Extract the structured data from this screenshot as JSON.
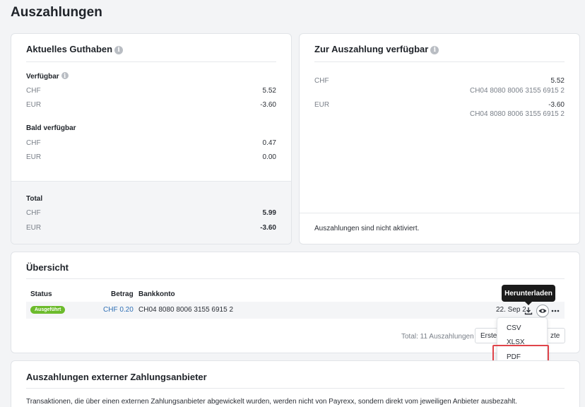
{
  "page": {
    "title": "Auszahlungen"
  },
  "balance": {
    "title": "Aktuelles Guthaben",
    "available": {
      "label": "Verfügbar",
      "rows": [
        {
          "currency": "CHF",
          "amount": "5.52"
        },
        {
          "currency": "EUR",
          "amount": "-3.60"
        }
      ]
    },
    "soon": {
      "label": "Bald verfügbar",
      "rows": [
        {
          "currency": "CHF",
          "amount": "0.47"
        },
        {
          "currency": "EUR",
          "amount": "0.00"
        }
      ]
    },
    "total": {
      "label": "Total",
      "rows": [
        {
          "currency": "CHF",
          "amount": "5.99"
        },
        {
          "currency": "EUR",
          "amount": "-3.60"
        }
      ]
    }
  },
  "payout_available": {
    "title": "Zur Auszahlung verfügbar",
    "rows": [
      {
        "currency": "CHF",
        "amount": "5.52",
        "iban": "CH04 8080 8006 3155 6915 2"
      },
      {
        "currency": "EUR",
        "amount": "-3.60",
        "iban": "CH04 8080 8006 3155 6915 2"
      }
    ],
    "footer": "Auszahlungen sind nicht aktiviert."
  },
  "overview": {
    "title": "Übersicht",
    "columns": {
      "status": "Status",
      "amount": "Betrag",
      "account": "Bankkonto"
    },
    "row": {
      "status": "Ausgeführt",
      "amount": "CHF 0.20",
      "account": "CH04 8080 8006 3155 6915 2",
      "date": "22. Sep 2"
    },
    "tooltip": "Herunterladen",
    "download_menu": [
      "CSV",
      "XLSX",
      "PDF"
    ],
    "pager": {
      "total": "Total: 11 Auszahlungen",
      "first": "Erste",
      "last": "zte"
    }
  },
  "external": {
    "title": "Auszahlungen externer Zahlungsanbieter",
    "text": "Transaktionen, die über einen externen Zahlungsanbieter abgewickelt wurden, werden nicht von Payrexx, sondern direkt vom jeweiligen Anbieter ausbezahlt."
  },
  "colors": {
    "accent_link": "#2f6fb5",
    "status_success": "#6cbb2c",
    "highlight": "#e0444a",
    "tooltip_bg": "#1b1b1b"
  }
}
